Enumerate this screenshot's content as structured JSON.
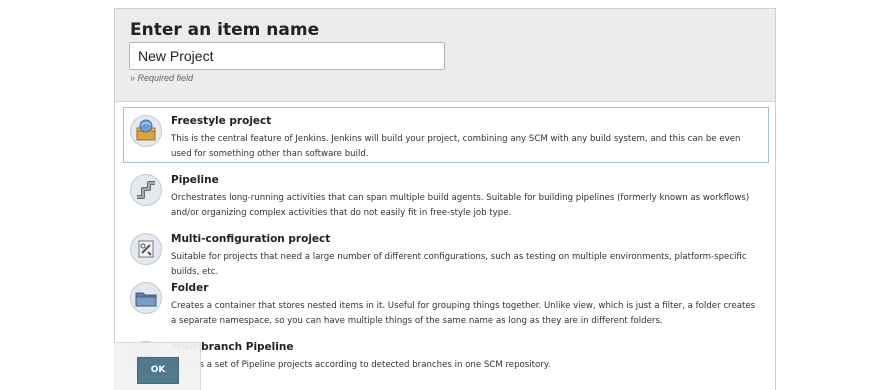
{
  "form": {
    "heading": "Enter an item name",
    "item_name_value": "New Project",
    "required_hint": "» Required field"
  },
  "item_types": [
    {
      "title": "Freestyle project",
      "description": "This is the central feature of Jenkins. Jenkins will build your project, combining any SCM with any build system, and this can be even used for something other than software build.",
      "icon": "freestyle-project-icon",
      "selected": true
    },
    {
      "title": "Pipeline",
      "description": "Orchestrates long-running activities that can span multiple build agents. Suitable for building pipelines (formerly known as workflows) and/or organizing complex activities that do not easily fit in free-style job type.",
      "icon": "pipeline-icon",
      "selected": false
    },
    {
      "title": "Multi-configuration project",
      "description": "Suitable for projects that need a large number of different configurations, such as testing on multiple environments, platform-specific builds, etc.",
      "icon": "multi-configuration-icon",
      "selected": false
    },
    {
      "title": "Folder",
      "description": "Creates a container that stores nested items in it. Useful for grouping things together. Unlike view, which is just a filter, a folder creates a separate namespace, so you can have multiple things of the same name as long as they are in different folders.",
      "icon": "folder-icon",
      "selected": false
    },
    {
      "title": "Multibranch Pipeline",
      "description": "Creates a set of Pipeline projects according to detected branches in one SCM repository.",
      "icon": "multibranch-pipeline-icon",
      "selected": false
    }
  ],
  "actions": {
    "ok_label": "OK"
  },
  "colors": {
    "selected_border": "#9fbfdf",
    "ok_button": "#4b758b",
    "header_bg": "#ececec"
  }
}
